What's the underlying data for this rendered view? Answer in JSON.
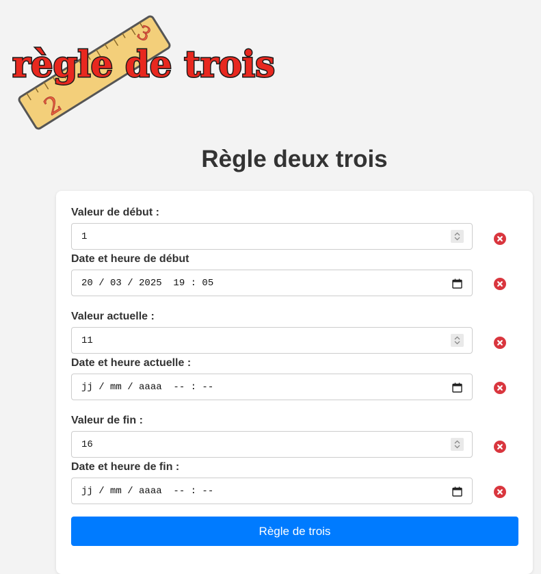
{
  "logo": {
    "text": "règle de trois",
    "ruler_numbers": [
      "2",
      "3"
    ],
    "colors": {
      "text_fill": "#e8281f",
      "text_outline": "#1a1a1a",
      "ruler_fill": "#f3cf7a",
      "ruler_outline": "#555555",
      "ruler_numbers": "#e8643a"
    }
  },
  "page": {
    "title": "Règle deux trois"
  },
  "form": {
    "start_value": {
      "label": "Valeur de début :",
      "value": "1"
    },
    "start_datetime": {
      "label": "Date et heure de début",
      "value": "20 / 03 / 2025  19 : 05"
    },
    "current_value": {
      "label": "Valeur actuelle :",
      "value": "11"
    },
    "current_datetime": {
      "label": "Date et heure actuelle :",
      "value": "jj / mm / aaaa  -- : --"
    },
    "end_value": {
      "label": "Valeur de fin :",
      "value": "16"
    },
    "end_datetime": {
      "label": "Date et heure de fin :",
      "value": "jj / mm / aaaa  -- : --"
    },
    "submit_label": "Règle de trois"
  },
  "icons": {
    "clear": "clear-icon",
    "spinner": "spinner-icon",
    "calendar": "calendar-icon"
  },
  "colors": {
    "background": "#f3f3f3",
    "card": "#ffffff",
    "primary_button": "#007bff",
    "clear_button": "#d9363e",
    "text": "#333333"
  }
}
